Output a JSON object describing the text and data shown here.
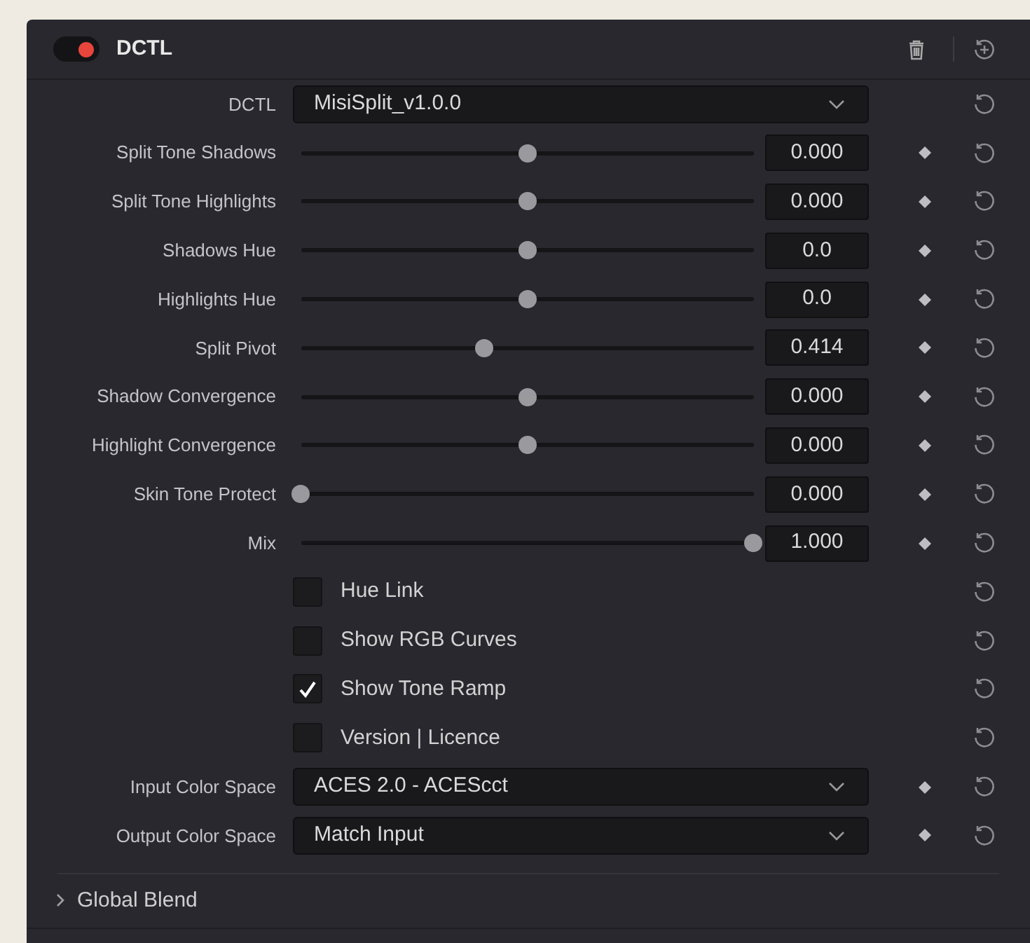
{
  "header": {
    "title": "DCTL",
    "enabled": true
  },
  "rows": [
    {
      "kind": "dropdown",
      "label": "DCTL",
      "value": "MisiSplit_v1.0.0",
      "keyframe": false
    },
    {
      "kind": "slider",
      "label": "Split Tone Shadows",
      "level": 0.5,
      "value": "0.000",
      "keyframe": true
    },
    {
      "kind": "slider",
      "label": "Split Tone Highlights",
      "level": 0.5,
      "value": "0.000",
      "keyframe": true
    },
    {
      "kind": "slider",
      "label": "Shadows Hue",
      "level": 0.5,
      "value": "0.0",
      "keyframe": true
    },
    {
      "kind": "slider",
      "label": "Highlights Hue",
      "level": 0.5,
      "value": "0.0",
      "keyframe": true
    },
    {
      "kind": "slider",
      "label": "Split Pivot",
      "level": 0.405,
      "value": "0.414",
      "keyframe": true
    },
    {
      "kind": "slider",
      "label": "Shadow Convergence",
      "level": 0.5,
      "value": "0.000",
      "keyframe": true
    },
    {
      "kind": "slider",
      "label": "Highlight Convergence",
      "level": 0.5,
      "value": "0.000",
      "keyframe": true
    },
    {
      "kind": "slider",
      "label": "Skin Tone Protect",
      "level": 0,
      "value": "0.000",
      "keyframe": true
    },
    {
      "kind": "slider",
      "label": "Mix",
      "level": 1,
      "value": "1.000",
      "keyframe": true
    },
    {
      "kind": "checkbox",
      "label": "Hue Link",
      "checked": false,
      "keyframe": false
    },
    {
      "kind": "checkbox",
      "label": "Show RGB Curves",
      "checked": false,
      "keyframe": false
    },
    {
      "kind": "checkbox",
      "label": "Show Tone Ramp",
      "checked": true,
      "keyframe": false
    },
    {
      "kind": "checkbox",
      "label": "Version | Licence",
      "checked": false,
      "keyframe": false
    },
    {
      "kind": "dropdown",
      "label": "Input Color Space",
      "value": "ACES 2.0 - ACEScct",
      "keyframe": true
    },
    {
      "kind": "dropdown",
      "label": "Output Color Space",
      "value": "Match Input",
      "keyframe": true
    }
  ],
  "section": {
    "label": "Global Blend",
    "expanded": false
  }
}
